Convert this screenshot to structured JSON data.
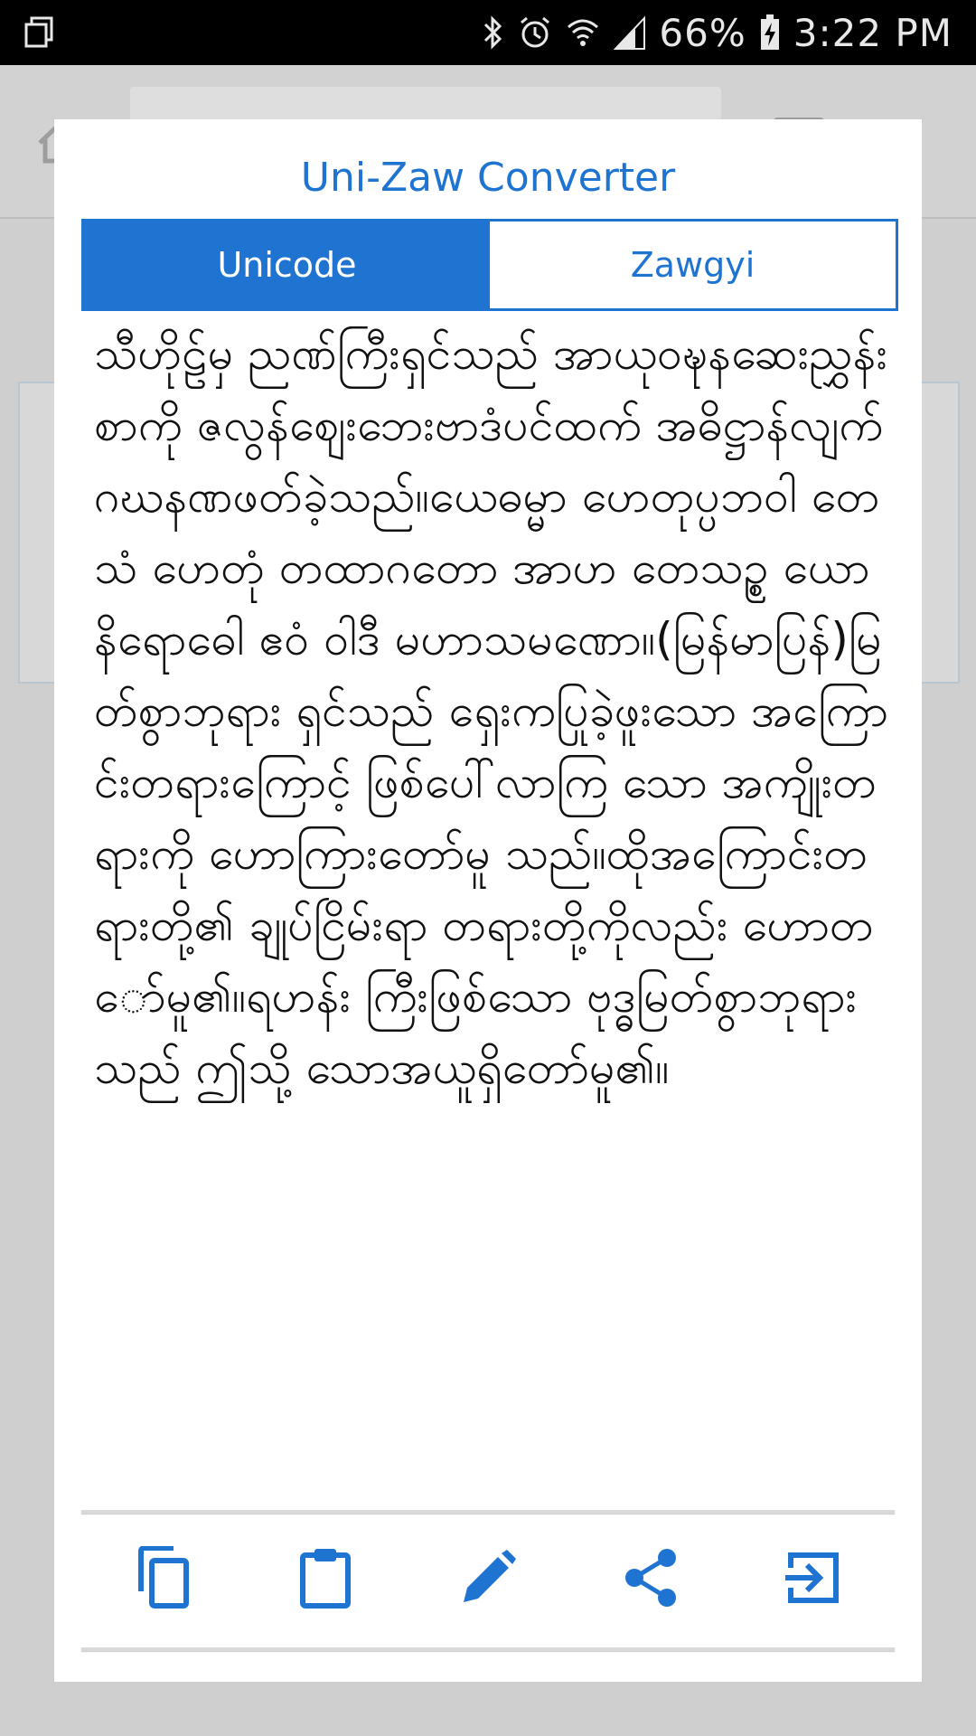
{
  "status_bar": {
    "battery": "66%",
    "time": "3:22 PM",
    "icons": [
      "copy-notification-icon",
      "bluetooth-icon",
      "alarm-icon",
      "wifi-icon",
      "signal-icon",
      "battery-charging-icon"
    ]
  },
  "background_app": {
    "icons": [
      "home-icon",
      "menu-icon"
    ]
  },
  "dialog": {
    "title": "Uni-Zaw Converter",
    "tabs": [
      {
        "label": "Unicode",
        "active": true
      },
      {
        "label": "Zawgyi",
        "active": false
      }
    ],
    "content_text": "သီဟိုဠ်မှ ညဏ်ကြီးရှင်သည် အာယုဝဍ္ဎနဆေးညွှန်းစာကို ဇလွန်ဈေးဘေးဗာဒံပင်ထက် အဓိဋ္ဌာန်လျက် ဂဃနဏဖတ်ခဲ့သည်။ယေဓမ္မာ ဟေတုပ္ပဘဝါ တေသံ ဟေတုံ တထာဂတော အာဟ တေသဉ္စ ယောနိရောဓေါ ဧဝံ ဝါဒီ မဟာသမဏော။(မြန်မာပြန်)မြတ်စွာဘုရား ရှင်သည် ရှေးကပြုခဲ့ဖူးသော အကြောင်းတရားကြောင့် ဖြစ်ပေါ်လာကြ သော အကျိုးတရားကို ဟောကြားတော်မူ သည်။ထိုအကြောင်းတရားတို့၏ ချုပ်ငြိမ်းရာ တရားတို့ကိုလည်း ဟောတော်မူ၏။ရဟန်း ကြီးဖြစ်သော ဗုဒ္ဓမြတ်စွာဘုရားသည် ဤသို့ သောအယူရှိတော်မူ၏။",
    "actions": [
      {
        "name": "copy-button",
        "icon": "copy-icon"
      },
      {
        "name": "paste-button",
        "icon": "clipboard-icon"
      },
      {
        "name": "edit-button",
        "icon": "pencil-icon"
      },
      {
        "name": "share-button",
        "icon": "share-icon"
      },
      {
        "name": "import-button",
        "icon": "input-icon"
      }
    ],
    "accent_color": "#1F74D2"
  }
}
